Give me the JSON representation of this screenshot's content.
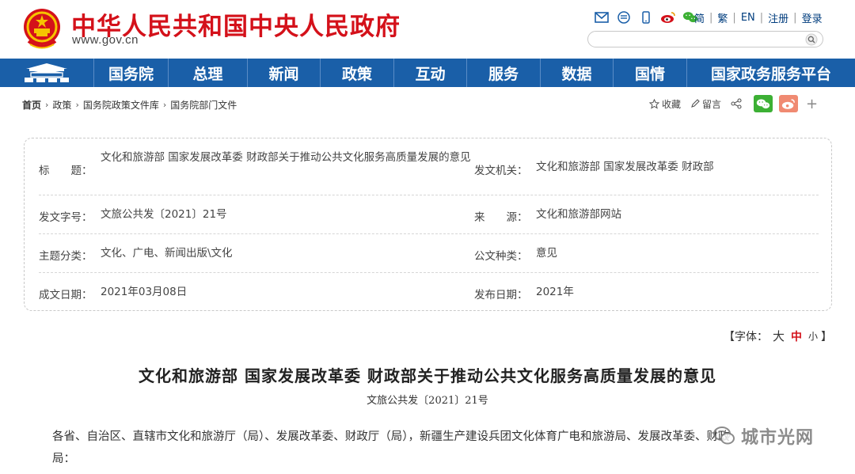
{
  "header": {
    "title": "中华人民共和国中央人民政府",
    "domain": "www.gov.cn",
    "icons": [
      "mail-icon",
      "rss-icon",
      "mobile-icon",
      "weibo-icon",
      "wechat-icon"
    ],
    "lang": [
      "简",
      "繁",
      "EN",
      "注册",
      "登录"
    ],
    "search_placeholder": ""
  },
  "nav": {
    "items": [
      "国务院",
      "总理",
      "新闻",
      "政策",
      "互动",
      "服务",
      "数据",
      "国情",
      "国家政务服务平台"
    ]
  },
  "breadcrumb": [
    "首页",
    "政策",
    "国务院政策文件库",
    "国务院部门文件"
  ],
  "tools": {
    "collect": "收藏",
    "comment": "留言",
    "plus": "+"
  },
  "info": {
    "title_label": "标　　题：",
    "title_value": "文化和旅游部 国家发展改革委 财政部关于推动公共文化服务高质量发展的意见",
    "issuer_label": "发文机关：",
    "issuer_value": "文化和旅游部 国家发展改革委 财政部",
    "docno_label": "发文字号：",
    "docno_value": "文旅公共发〔2021〕21号",
    "source_label": "来　　源：",
    "source_value": "文化和旅游部网站",
    "topic_label": "主题分类：",
    "topic_value": "文化、广电、新闻出版\\文化",
    "type_label": "公文种类：",
    "type_value": "意见",
    "date_label": "成文日期：",
    "date_value": "2021年03月08日",
    "pub_label": "发布日期：",
    "pub_value": "2021年"
  },
  "fontsize": {
    "open": "【字体：",
    "big": "大",
    "mid": "中",
    "small": "小",
    "close": "】"
  },
  "article": {
    "title": "文化和旅游部 国家发展改革委 财政部关于推动公共文化服务高质量发展的意见",
    "doc_number": "文旅公共发〔2021〕21号",
    "body_line1": "各省、自治区、直辖市文化和旅游厅（局）、发展改革委、财政厅（局），新疆生产建设兵团文化体育广电和旅游局、发展改革委、财政",
    "body_line2": "局："
  },
  "watermark": "城市光网",
  "colors": {
    "brand_red": "#d4111a",
    "nav_blue": "#1a5fa8",
    "link_blue": "#003d7e"
  }
}
